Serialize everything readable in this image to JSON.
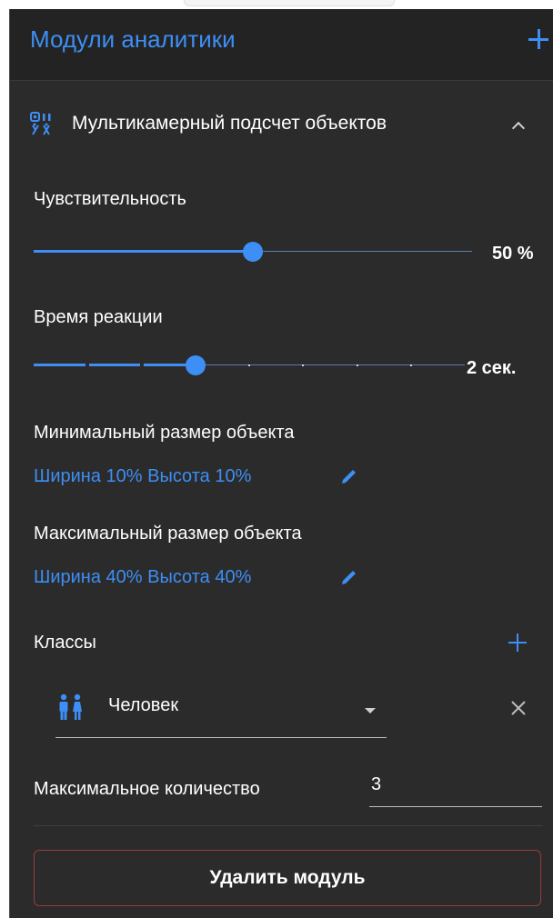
{
  "header": {
    "title": "Модули аналитики",
    "add_icon": "plus-icon"
  },
  "module": {
    "icon": "multicamera-count-icon",
    "title": "Мультикамерный подсчет объектов",
    "expanded": true
  },
  "sensitivity": {
    "label": "Чувствительность",
    "value_text": "50 %",
    "value": 50
  },
  "reaction_time": {
    "label": "Время реакции",
    "value_text": "2 сек.",
    "value": 2,
    "step_index": 3,
    "steps": 9
  },
  "min_size": {
    "label": "Минимальный размер объекта",
    "link": "Ширина 10% Высота 10%"
  },
  "max_size": {
    "label": "Максимальный размер объекта",
    "link": "Ширина 40% Высота 40%"
  },
  "classes": {
    "label": "Классы",
    "items": [
      {
        "name": "Человек",
        "icon": "person-pair-icon"
      }
    ]
  },
  "max_count": {
    "label": "Максимальное количество",
    "value": "3"
  },
  "delete_button": {
    "label": "Удалить модуль"
  },
  "colors": {
    "accent": "#3d8ff5",
    "panel_bg": "#2b2b2b",
    "header_bg": "#232323",
    "danger_border": "#9b3a3a"
  }
}
